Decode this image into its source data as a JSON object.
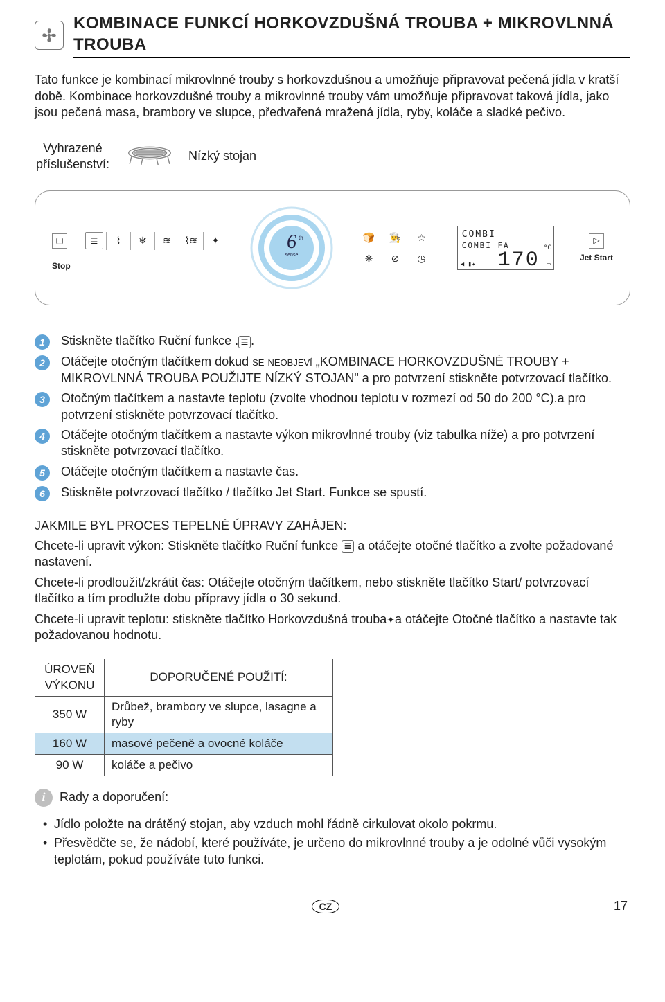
{
  "header": {
    "title": "KOMBINACE FUNKCÍ HORKOVZDUŠNÁ TROUBA + MIKROVLNNÁ TROUBA"
  },
  "intro": {
    "p1": "Tato funkce je kombinací mikrovlnné trouby s horkovzdušnou a umožňuje připravovat pečená jídla v kratší době. Kombinace horkovzdušné trouby a mikrovlnné trouby vám umožňuje připravovat taková jídla, jako jsou pečená masa, brambory ve slupce, předvařená mražená jídla, ryby, koláče a sladké pečivo."
  },
  "accessory": {
    "label": "Vyhrazené příslušenství:",
    "name": "Nízký stojan"
  },
  "panel": {
    "stop_label": "Stop",
    "jet_label": "Jet Start",
    "lcd": {
      "line1": "COMBI",
      "line2": "COMBI  FA",
      "temp": "170",
      "unit": "°C"
    }
  },
  "steps": [
    {
      "n": "1",
      "html": "Stiskněte tlačítko Ruční funkce ."
    },
    {
      "n": "2",
      "html": "Otáčejte otočným tlačítkem dokud SE NEOBJEVÍ „KOMBINACE HORKOVZDUŠNÉ TROUBY + MIKROVLNNÁ TROUBA POUŽIJTE NÍZKÝ STOJAN\" a pro potvrzení stiskněte potvrzovací tlačítko."
    },
    {
      "n": "3",
      "html": "Otočným tlačítkem a nastavte teplotu (zvolte vhodnou teplotu v rozmezí od 50 do 200 °C).a pro potvrzení stiskněte potvrzovací tlačítko."
    },
    {
      "n": "4",
      "html": "Otáčejte otočným tlačítkem a nastavte výkon mikrovlnné trouby (viz tabulka níže) a pro potvrzení stiskněte potvrzovací tlačítko."
    },
    {
      "n": "5",
      "html": "Otáčejte otočným tlačítkem a nastavte čas."
    },
    {
      "n": "6",
      "html": "Stiskněte potvrzovací tlačítko / tlačítko Jet Start. Funkce se spustí."
    }
  ],
  "after": {
    "heading": "Jakmile byl proces tepelné úpravy zahájen:",
    "p1a": "Chcete-li upravit výkon: Stiskněte tlačítko Ruční funkce ",
    "p1b": " a otáčejte otočné tlačítko a zvolte požadované nastavení.",
    "p2": "Chcete-li prodloužit/zkrátit čas: Otáčejte otočným tlačítkem, nebo stiskněte tlačítko Start/ potvrzovací tlačítko a tím prodlužte dobu přípravy jídla o 30 sekund.",
    "p3a": "Chcete-li upravit teplotu: stiskněte tlačítko Horkovzdušná trouba",
    "p3b": "a otáčejte Otočné tlačítko a nastavte tak požadovanou hodnotu."
  },
  "table": {
    "head_power": "ÚROVEŇ VÝKONU",
    "head_use": "DOPORUČENÉ POUŽITÍ:",
    "rows": [
      {
        "w": "350 W",
        "use": "Drůbež, brambory ve slupce, lasagne a ryby",
        "hi": false
      },
      {
        "w": "160 W",
        "use": "masové pečeně a ovocné koláče",
        "hi": true
      },
      {
        "w": "90 W",
        "use": "koláče a pečivo",
        "hi": false
      }
    ]
  },
  "tips": {
    "heading": "Rady a doporučení:",
    "items": [
      "Jídlo položte na drátěný stojan, aby vzduch mohl řádně cirkulovat okolo pokrmu.",
      "Přesvědčte se, že nádobí, které používáte, je určeno do mikrovlnné trouby a je odolné vůči vysokým teplotám, pokud používáte tuto funkci."
    ]
  },
  "footer": {
    "lang": "CZ",
    "page": "17"
  }
}
